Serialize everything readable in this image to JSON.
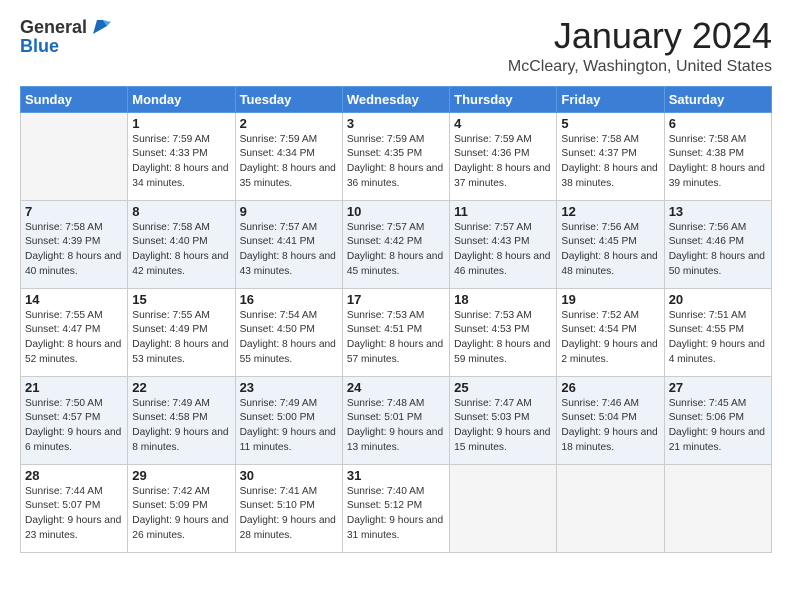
{
  "header": {
    "logo_general": "General",
    "logo_blue": "Blue",
    "month_title": "January 2024",
    "location": "McCleary, Washington, United States"
  },
  "days_of_week": [
    "Sunday",
    "Monday",
    "Tuesday",
    "Wednesday",
    "Thursday",
    "Friday",
    "Saturday"
  ],
  "weeks": [
    [
      {
        "day": "",
        "sunrise": "",
        "sunset": "",
        "daylight": ""
      },
      {
        "day": "1",
        "sunrise": "Sunrise: 7:59 AM",
        "sunset": "Sunset: 4:33 PM",
        "daylight": "Daylight: 8 hours and 34 minutes."
      },
      {
        "day": "2",
        "sunrise": "Sunrise: 7:59 AM",
        "sunset": "Sunset: 4:34 PM",
        "daylight": "Daylight: 8 hours and 35 minutes."
      },
      {
        "day": "3",
        "sunrise": "Sunrise: 7:59 AM",
        "sunset": "Sunset: 4:35 PM",
        "daylight": "Daylight: 8 hours and 36 minutes."
      },
      {
        "day": "4",
        "sunrise": "Sunrise: 7:59 AM",
        "sunset": "Sunset: 4:36 PM",
        "daylight": "Daylight: 8 hours and 37 minutes."
      },
      {
        "day": "5",
        "sunrise": "Sunrise: 7:58 AM",
        "sunset": "Sunset: 4:37 PM",
        "daylight": "Daylight: 8 hours and 38 minutes."
      },
      {
        "day": "6",
        "sunrise": "Sunrise: 7:58 AM",
        "sunset": "Sunset: 4:38 PM",
        "daylight": "Daylight: 8 hours and 39 minutes."
      }
    ],
    [
      {
        "day": "7",
        "sunrise": "Sunrise: 7:58 AM",
        "sunset": "Sunset: 4:39 PM",
        "daylight": "Daylight: 8 hours and 40 minutes."
      },
      {
        "day": "8",
        "sunrise": "Sunrise: 7:58 AM",
        "sunset": "Sunset: 4:40 PM",
        "daylight": "Daylight: 8 hours and 42 minutes."
      },
      {
        "day": "9",
        "sunrise": "Sunrise: 7:57 AM",
        "sunset": "Sunset: 4:41 PM",
        "daylight": "Daylight: 8 hours and 43 minutes."
      },
      {
        "day": "10",
        "sunrise": "Sunrise: 7:57 AM",
        "sunset": "Sunset: 4:42 PM",
        "daylight": "Daylight: 8 hours and 45 minutes."
      },
      {
        "day": "11",
        "sunrise": "Sunrise: 7:57 AM",
        "sunset": "Sunset: 4:43 PM",
        "daylight": "Daylight: 8 hours and 46 minutes."
      },
      {
        "day": "12",
        "sunrise": "Sunrise: 7:56 AM",
        "sunset": "Sunset: 4:45 PM",
        "daylight": "Daylight: 8 hours and 48 minutes."
      },
      {
        "day": "13",
        "sunrise": "Sunrise: 7:56 AM",
        "sunset": "Sunset: 4:46 PM",
        "daylight": "Daylight: 8 hours and 50 minutes."
      }
    ],
    [
      {
        "day": "14",
        "sunrise": "Sunrise: 7:55 AM",
        "sunset": "Sunset: 4:47 PM",
        "daylight": "Daylight: 8 hours and 52 minutes."
      },
      {
        "day": "15",
        "sunrise": "Sunrise: 7:55 AM",
        "sunset": "Sunset: 4:49 PM",
        "daylight": "Daylight: 8 hours and 53 minutes."
      },
      {
        "day": "16",
        "sunrise": "Sunrise: 7:54 AM",
        "sunset": "Sunset: 4:50 PM",
        "daylight": "Daylight: 8 hours and 55 minutes."
      },
      {
        "day": "17",
        "sunrise": "Sunrise: 7:53 AM",
        "sunset": "Sunset: 4:51 PM",
        "daylight": "Daylight: 8 hours and 57 minutes."
      },
      {
        "day": "18",
        "sunrise": "Sunrise: 7:53 AM",
        "sunset": "Sunset: 4:53 PM",
        "daylight": "Daylight: 8 hours and 59 minutes."
      },
      {
        "day": "19",
        "sunrise": "Sunrise: 7:52 AM",
        "sunset": "Sunset: 4:54 PM",
        "daylight": "Daylight: 9 hours and 2 minutes."
      },
      {
        "day": "20",
        "sunrise": "Sunrise: 7:51 AM",
        "sunset": "Sunset: 4:55 PM",
        "daylight": "Daylight: 9 hours and 4 minutes."
      }
    ],
    [
      {
        "day": "21",
        "sunrise": "Sunrise: 7:50 AM",
        "sunset": "Sunset: 4:57 PM",
        "daylight": "Daylight: 9 hours and 6 minutes."
      },
      {
        "day": "22",
        "sunrise": "Sunrise: 7:49 AM",
        "sunset": "Sunset: 4:58 PM",
        "daylight": "Daylight: 9 hours and 8 minutes."
      },
      {
        "day": "23",
        "sunrise": "Sunrise: 7:49 AM",
        "sunset": "Sunset: 5:00 PM",
        "daylight": "Daylight: 9 hours and 11 minutes."
      },
      {
        "day": "24",
        "sunrise": "Sunrise: 7:48 AM",
        "sunset": "Sunset: 5:01 PM",
        "daylight": "Daylight: 9 hours and 13 minutes."
      },
      {
        "day": "25",
        "sunrise": "Sunrise: 7:47 AM",
        "sunset": "Sunset: 5:03 PM",
        "daylight": "Daylight: 9 hours and 15 minutes."
      },
      {
        "day": "26",
        "sunrise": "Sunrise: 7:46 AM",
        "sunset": "Sunset: 5:04 PM",
        "daylight": "Daylight: 9 hours and 18 minutes."
      },
      {
        "day": "27",
        "sunrise": "Sunrise: 7:45 AM",
        "sunset": "Sunset: 5:06 PM",
        "daylight": "Daylight: 9 hours and 21 minutes."
      }
    ],
    [
      {
        "day": "28",
        "sunrise": "Sunrise: 7:44 AM",
        "sunset": "Sunset: 5:07 PM",
        "daylight": "Daylight: 9 hours and 23 minutes."
      },
      {
        "day": "29",
        "sunrise": "Sunrise: 7:42 AM",
        "sunset": "Sunset: 5:09 PM",
        "daylight": "Daylight: 9 hours and 26 minutes."
      },
      {
        "day": "30",
        "sunrise": "Sunrise: 7:41 AM",
        "sunset": "Sunset: 5:10 PM",
        "daylight": "Daylight: 9 hours and 28 minutes."
      },
      {
        "day": "31",
        "sunrise": "Sunrise: 7:40 AM",
        "sunset": "Sunset: 5:12 PM",
        "daylight": "Daylight: 9 hours and 31 minutes."
      },
      {
        "day": "",
        "sunrise": "",
        "sunset": "",
        "daylight": ""
      },
      {
        "day": "",
        "sunrise": "",
        "sunset": "",
        "daylight": ""
      },
      {
        "day": "",
        "sunrise": "",
        "sunset": "",
        "daylight": ""
      }
    ]
  ]
}
